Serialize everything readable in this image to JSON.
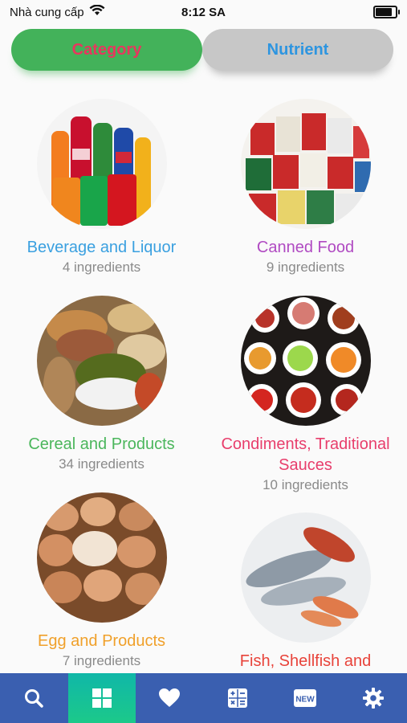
{
  "status_bar": {
    "carrier": "Nhà cung cấp",
    "time": "8:12 SA",
    "battery_level": 0.9
  },
  "tabs": {
    "category_label": "Category",
    "nutrient_label": "Nutrient",
    "selected": "Category"
  },
  "categories": [
    {
      "name": "Beverage and Liquor",
      "count": "4 ingredients",
      "name_color": "#3aa0e0"
    },
    {
      "name": "Canned Food",
      "count": "9 ingredients",
      "name_color": "#b04ac2"
    },
    {
      "name": "Cereal and Products",
      "count": "34 ingredients",
      "name_color": "#4bb65c"
    },
    {
      "name": "Condiments, Traditional Sauces",
      "count": "10 ingredients",
      "name_color": "#e83e6c"
    },
    {
      "name": "Egg and Products",
      "count": "7 ingredients",
      "name_color": "#f0a02a"
    },
    {
      "name": "Fish, Shellfish and",
      "count": "",
      "name_color": "#e8433a"
    }
  ],
  "bottom_nav": {
    "items": [
      {
        "icon": "search-icon",
        "active": false
      },
      {
        "icon": "category-grid-icon",
        "active": true
      },
      {
        "icon": "heart-icon",
        "active": false
      },
      {
        "icon": "calculator-icon",
        "active": false
      },
      {
        "icon": "new-badge-icon",
        "active": false
      },
      {
        "icon": "gear-icon",
        "active": false
      }
    ],
    "new_badge_text": "NEW"
  },
  "colors": {
    "tab_active_bg": "#43b25a",
    "tab_inactive_bg": "#c7c7c7",
    "nav_bg": "#3a5fb0",
    "nav_active_bg": "#10b7a8"
  }
}
